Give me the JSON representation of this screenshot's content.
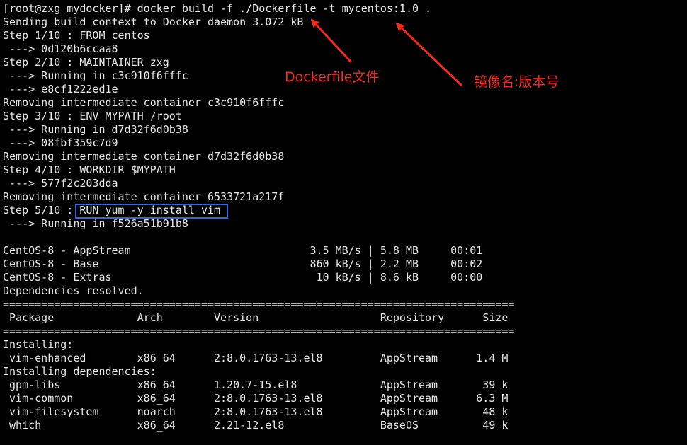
{
  "terminal": {
    "lines": [
      "[root@zxg mydocker]# docker build -f ./Dockerfile -t mycentos:1.0 .",
      "Sending build context to Docker daemon 3.072 kB",
      "Step 1/10 : FROM centos",
      " ---> 0d120b6ccaa8",
      "Step 2/10 : MAINTAINER zxg",
      " ---> Running in c3c910f6fffc",
      " ---> e8cf1222ed1e",
      "Removing intermediate container c3c910f6fffc",
      "Step 3/10 : ENV MYPATH /root",
      " ---> Running in d7d32f6d0b38",
      " ---> 08fbf359c7d9",
      "Removing intermediate container d7d32f6d0b38",
      "Step 4/10 : WORKDIR $MYPATH",
      " ---> 577f2c203dda",
      "Removing intermediate container 6533721a217f",
      "Step 5/10 : RUN yum -y install vim",
      " ---> Running in f526a51b91b8",
      "",
      "CentOS-8 - AppStream                            3.5 MB/s | 5.8 MB     00:01",
      "CentOS-8 - Base                                 860 kB/s | 2.2 MB     00:02",
      "CentOS-8 - Extras                                10 kB/s | 8.6 kB     00:00",
      "Dependencies resolved.",
      "================================================================================",
      " Package             Arch        Version                   Repository      Size",
      "================================================================================",
      "Installing:",
      " vim-enhanced        x86_64      2:8.0.1763-13.el8         AppStream      1.4 M",
      "Installing dependencies:",
      " gpm-libs            x86_64      1.20.7-15.el8             AppStream       39 k",
      " vim-common          x86_64      2:8.0.1763-13.el8         AppStream      6.3 M",
      " vim-filesystem      noarch      2:8.0.1763-13.el8         AppStream       48 k",
      " which               x86_64      2.21-12.el8               BaseOS          49 k"
    ]
  },
  "annotations": {
    "dockerfile_label": "Dockerfile文件",
    "image_tag_label": "镜像名:版本号",
    "color": "#f02b1c",
    "highlight_color": "#3366dd"
  }
}
